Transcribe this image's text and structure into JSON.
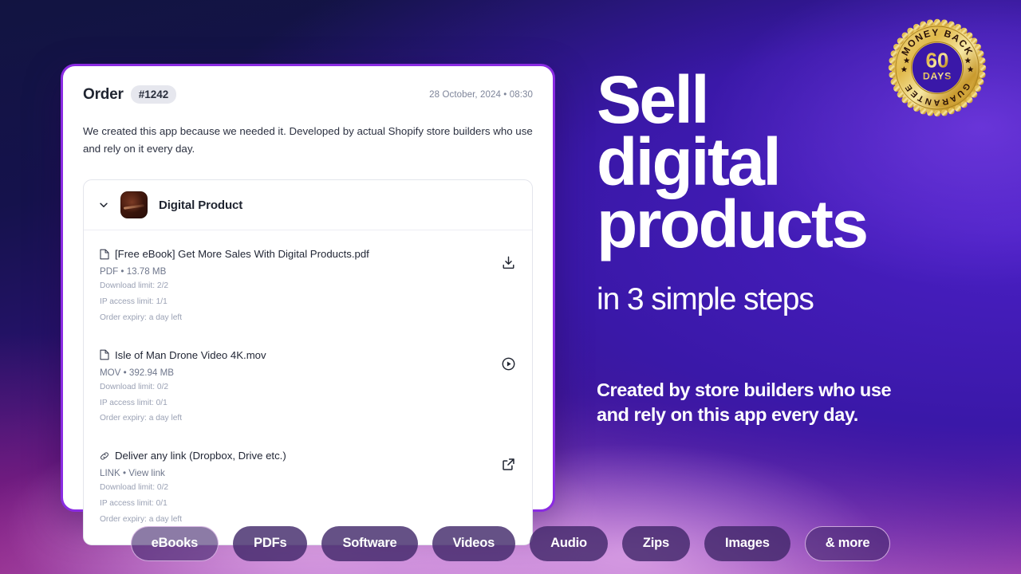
{
  "order_card": {
    "title": "Order",
    "order_number": "#1242",
    "date": "28 October, 2024 • 08:30",
    "description": "We created this app because we needed it. Developed by actual Shopify store builders who use and rely on it every day.",
    "product": {
      "name": "Digital Product",
      "chevron_icon": "chevron-down-icon",
      "thumbnail_icon": "product-thumbnail"
    },
    "files": [
      {
        "name": "[Free eBook] Get More Sales With Digital Products.pdf",
        "type_icon": "file-icon",
        "meta": "PDF • 13.78 MB",
        "download_limit": "Download limit: 2/2",
        "ip_access_limit": "IP access limit: 1/1",
        "order_expiry": "Order expiry: a day left",
        "action_icon": "download-icon"
      },
      {
        "name": "Isle of Man Drone Video 4K.mov",
        "type_icon": "file-icon",
        "meta": "MOV • 392.94 MB",
        "download_limit": "Download limit: 0/2",
        "ip_access_limit": "IP access limit: 0/1",
        "order_expiry": "Order expiry: a day left",
        "action_icon": "play-circle-icon"
      },
      {
        "name": "Deliver any link (Dropbox, Drive etc.)",
        "type_icon": "link-icon",
        "meta": "LINK • View link",
        "download_limit": "Download limit: 0/2",
        "ip_access_limit": "IP access limit: 0/1",
        "order_expiry": "Order expiry: a day left",
        "action_icon": "external-link-icon"
      }
    ]
  },
  "hero": {
    "headline_line1": "Sell",
    "headline_line2": "digital",
    "headline_line3": "products",
    "subhead": "in 3 simple steps",
    "tagline_line1": "Created by store builders who use",
    "tagline_line2": "and rely on this app every day."
  },
  "badge": {
    "top_text": "MONEY BACK",
    "number": "60",
    "unit": "DAYS",
    "bottom_text": "GUARANTEE",
    "gold": "#e8c254",
    "gold_dark": "#b8902c",
    "center": "#3a18a8"
  },
  "pills": [
    {
      "label": "eBooks",
      "style": "outlined"
    },
    {
      "label": "PDFs",
      "style": "solid"
    },
    {
      "label": "Software",
      "style": "solid"
    },
    {
      "label": "Videos",
      "style": "solid"
    },
    {
      "label": "Audio",
      "style": "solid"
    },
    {
      "label": "Zips",
      "style": "solid"
    },
    {
      "label": "Images",
      "style": "solid"
    },
    {
      "label": "& more",
      "style": "outlined"
    }
  ],
  "colors": {
    "card_border": "#8a2be2",
    "accent_purple": "#5b1a96",
    "bg_top": "#121441",
    "bg_bottom": "#a93fa8"
  }
}
